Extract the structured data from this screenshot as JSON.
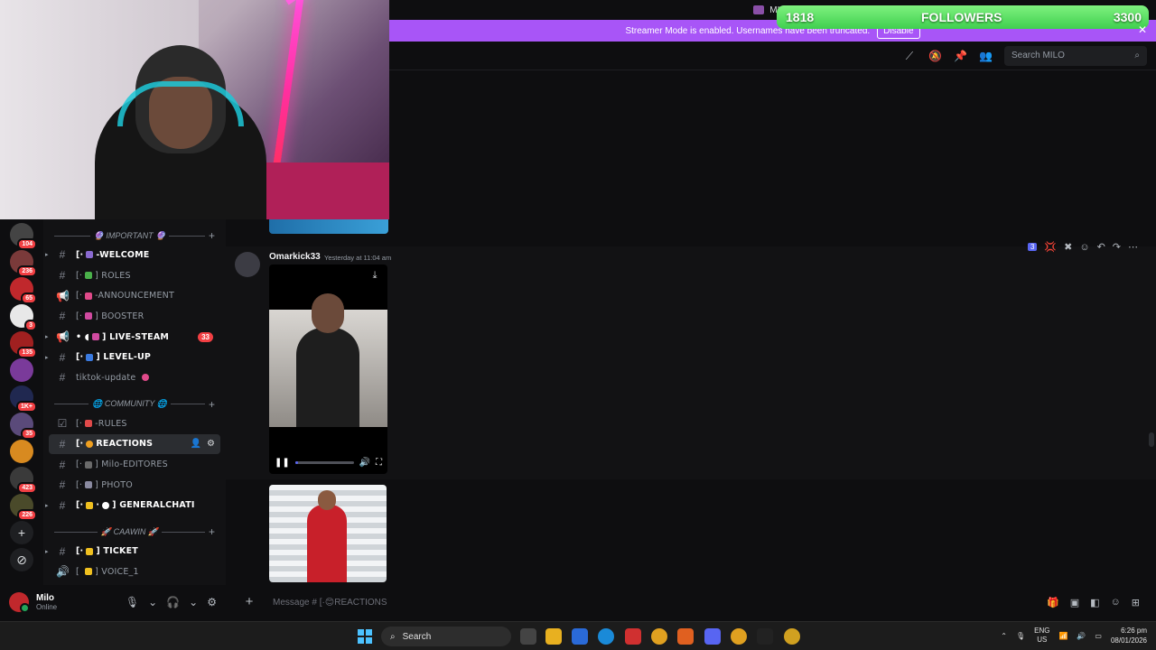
{
  "window": {
    "server_title": "MILO"
  },
  "followers_goal": {
    "current": "1818",
    "label": "FOLLOWERS",
    "goal": "3300"
  },
  "banner": {
    "text": "Streamer Mode is enabled. Usernames have been truncated.",
    "button": "Disable"
  },
  "header": {
    "search_placeholder": "Search MILO"
  },
  "rail": {
    "badges": [
      "104",
      "236",
      "65",
      "3",
      "135",
      "1K+",
      "35",
      "423",
      "226"
    ]
  },
  "categories": {
    "important": "IMPORTANT",
    "community": "COMMUNITY",
    "caawin": "CAAWIN"
  },
  "channels": {
    "welcome": "-WELCOME",
    "roles": "ROLES",
    "announcement": "-ANNOUNCEMENT",
    "booster": "BOOSTER",
    "live_stream": "LIVE-STEAM",
    "live_stream_mentions": "33",
    "level_up": "LEVEL-UP",
    "tiktok": "tiktok-update",
    "rules": "-RULES",
    "reactions": "REACTIONS",
    "milo_editores": "Milo-EDITORES",
    "photo": "PHOTO",
    "generalchat": "GENERALCHATI",
    "ticket": "TICKET",
    "voice": "VOICE_1"
  },
  "user": {
    "name": "Milo",
    "status": "Online"
  },
  "message": {
    "author": "Omarkick33",
    "timestamp": "Yesterday at 11:04 am",
    "video_progress": 0.05,
    "toolbar_count": "3"
  },
  "composer": {
    "placeholder": "Message # [·😊REACTIONS"
  },
  "taskbar": {
    "search": "Search",
    "lang_top": "ENG",
    "lang_bottom": "US",
    "time": "6:26 pm",
    "date": "08/01/2026"
  }
}
